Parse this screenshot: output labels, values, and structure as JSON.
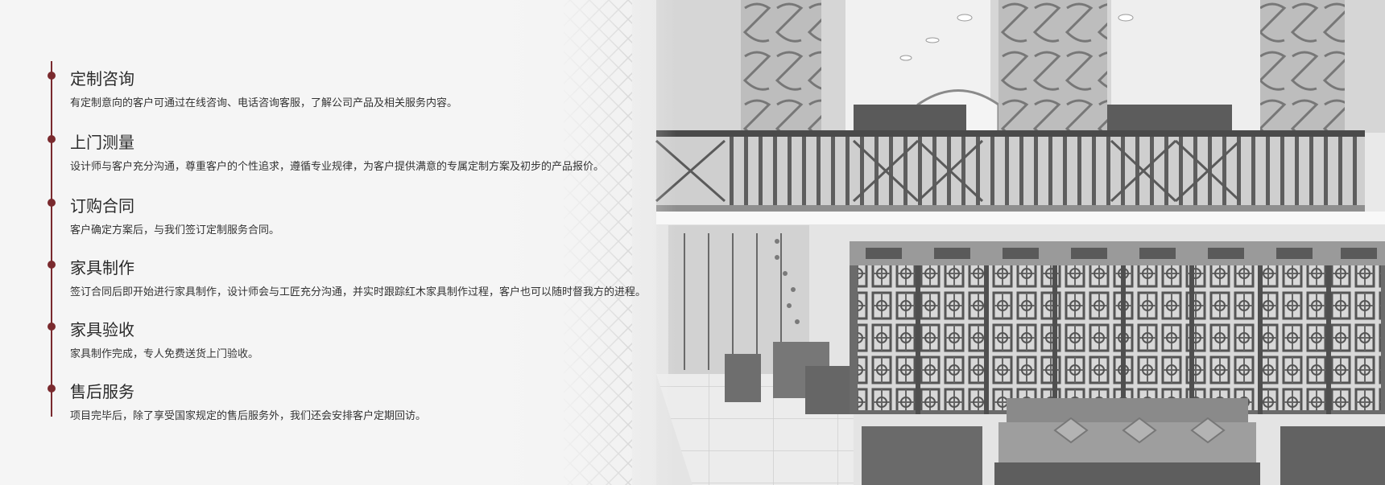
{
  "steps": [
    {
      "title": "定制咨询",
      "desc": "有定制意向的客户可通过在线咨询、电话咨询客服，了解公司产品及相关服务内容。"
    },
    {
      "title": "上门测量",
      "desc": "设计师与客户充分沟通，尊重客户的个性追求，遵循专业规律，为客户提供满意的专属定制方案及初步的产品报价。"
    },
    {
      "title": "订购合同",
      "desc": "客户确定方案后，与我们签订定制服务合同。"
    },
    {
      "title": "家具制作",
      "desc": "签订合同后即开始进行家具制作，设计师会与工匠充分沟通，并实时跟踪红木家具制作过程，客户也可以随时督我方的进程。"
    },
    {
      "title": "家具验收",
      "desc": "家具制作完成，专人免费送货上门验收。"
    },
    {
      "title": "售后服务",
      "desc": "项目完毕后，除了享受国家规定的售后服务外，我们还会安排客户定期回访。"
    }
  ],
  "colors": {
    "accent": "#7a2a2e",
    "background": "#f5f5f5",
    "title_text": "#2a2a2a",
    "desc_text": "#333333"
  }
}
